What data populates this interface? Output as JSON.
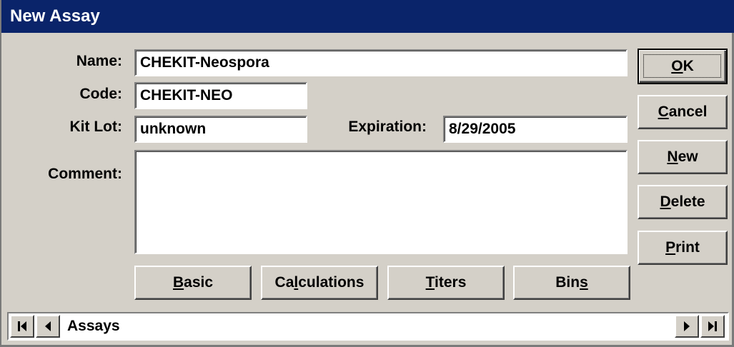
{
  "window": {
    "title": "New Assay"
  },
  "form": {
    "name_label": "Name:",
    "name_value": "CHEKIT-Neospora",
    "code_label": "Code:",
    "code_value": "CHEKIT-NEO",
    "kitlot_label": "Kit Lot:",
    "kitlot_value": "unknown",
    "expiration_label": "Expiration:",
    "expiration_value": "8/29/2005",
    "comment_label": "Comment:",
    "comment_value": ""
  },
  "side_buttons": {
    "ok": {
      "mnemonic": "O",
      "rest": "K"
    },
    "cancel": {
      "mnemonic": "C",
      "rest": "ancel"
    },
    "new": {
      "mnemonic": "N",
      "rest": "ew"
    },
    "delete": {
      "mnemonic": "D",
      "rest": "elete"
    },
    "print": {
      "mnemonic": "P",
      "rest": "rint"
    }
  },
  "tab_buttons": {
    "basic": {
      "pre": "",
      "mnemonic": "B",
      "rest": "asic"
    },
    "calculations": {
      "pre": "Ca",
      "mnemonic": "l",
      "rest": "culations"
    },
    "titers": {
      "pre": "",
      "mnemonic": "T",
      "rest": "iters"
    },
    "bins": {
      "pre": "Bin",
      "mnemonic": "s",
      "rest": ""
    }
  },
  "nav": {
    "label": "Assays"
  },
  "icons": {
    "first": "first-record-icon",
    "prev": "previous-record-icon",
    "next": "next-record-icon",
    "last": "last-record-icon"
  }
}
